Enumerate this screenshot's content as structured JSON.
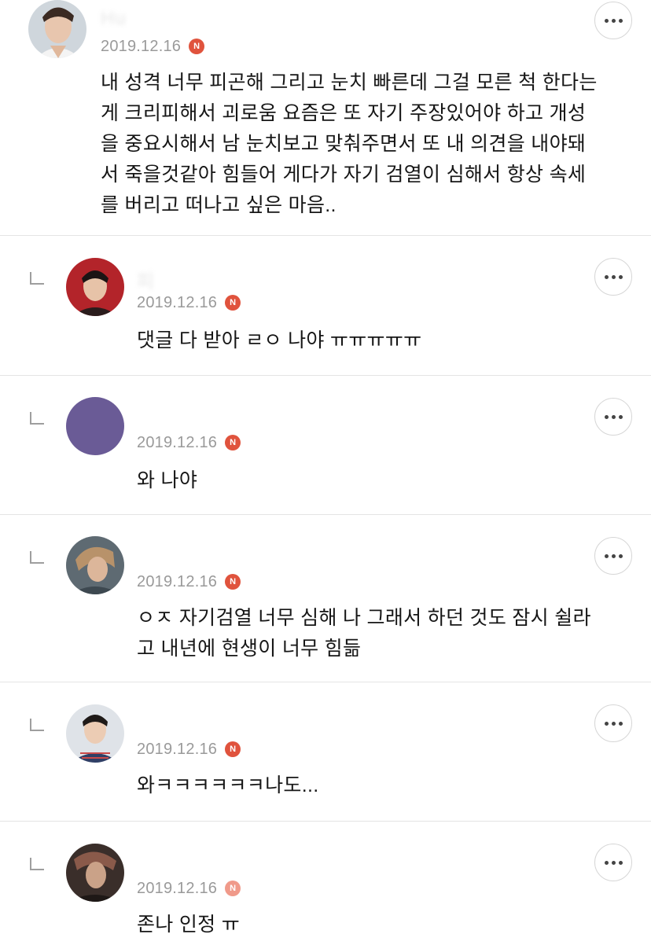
{
  "comments": [
    {
      "date": "2019.12.16",
      "badge": "N",
      "text": "내 성격 너무 피곤해 그리고 눈치 빠른데 그걸 모른 척 한다는\n게 크리피해서 괴로움 요즘은 또 자기 주장있어야 하고 개성\n을 중요시해서 남 눈치보고 맞춰주면서 또 내 의견을 내야돼\n서 죽을것같아 힘들어 게다가 자기 검열이 심해서 항상 속세\n를 버리고 떠나고 싶은 마음.."
    },
    {
      "date": "2019.12.16",
      "badge": "N",
      "text": "댓글 다 받아 ㄹㅇ 나야 ㅠㅠㅠㅠㅠ"
    },
    {
      "date": "2019.12.16",
      "badge": "N",
      "text": "와 나야"
    },
    {
      "date": "2019.12.16",
      "badge": "N",
      "text": "ㅇㅈ 자기검열 너무 심해 나 그래서 하던 것도 잠시 쉴라\n고 내년에 현생이 너무 힘듦"
    },
    {
      "date": "2019.12.16",
      "badge": "N",
      "text": "와ㅋㅋㅋㅋㅋㅋ나도..."
    },
    {
      "date": "2019.12.16",
      "badge": "N",
      "text": "존나 인정 ㅠ"
    }
  ],
  "icons": {
    "more": "more-horizontal-icon",
    "badge": "n-badge-icon",
    "reply": "reply-indent-icon"
  },
  "colors": {
    "badge": "#e0533d",
    "date": "#9a9a9a",
    "divider": "#e4e4e4"
  }
}
